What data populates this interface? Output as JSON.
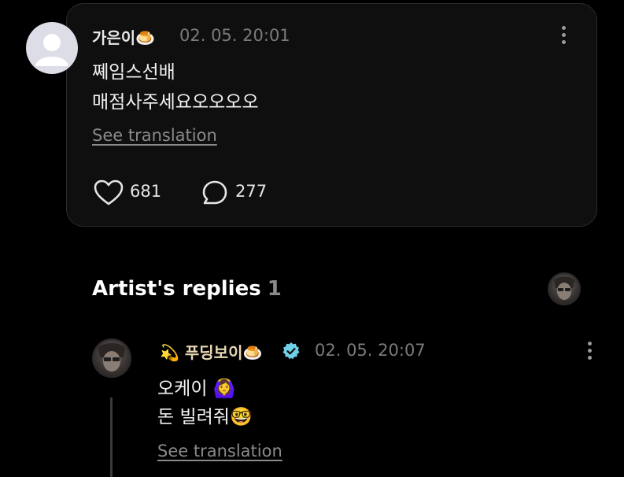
{
  "comment": {
    "username": "가은이🍮",
    "timestamp": "02. 05. 20:01",
    "lines": [
      "쪠임스선배",
      "매점사주세요오오오오"
    ],
    "see_translation": "See translation",
    "likes": "681",
    "replies": "277"
  },
  "artist_replies": {
    "title": "Artist's replies",
    "count": "1"
  },
  "reply": {
    "username": "💫 푸딩보이🍮",
    "timestamp": "02. 05. 20:07",
    "lines": [
      "오케이 🙆‍♀️",
      "돈 빌려줘🤓"
    ],
    "see_translation": "See translation"
  },
  "colors": {
    "background": "#000000",
    "card": "#0f0f0f",
    "muted": "#7a7a7a",
    "verified": "#6fd0e8"
  }
}
